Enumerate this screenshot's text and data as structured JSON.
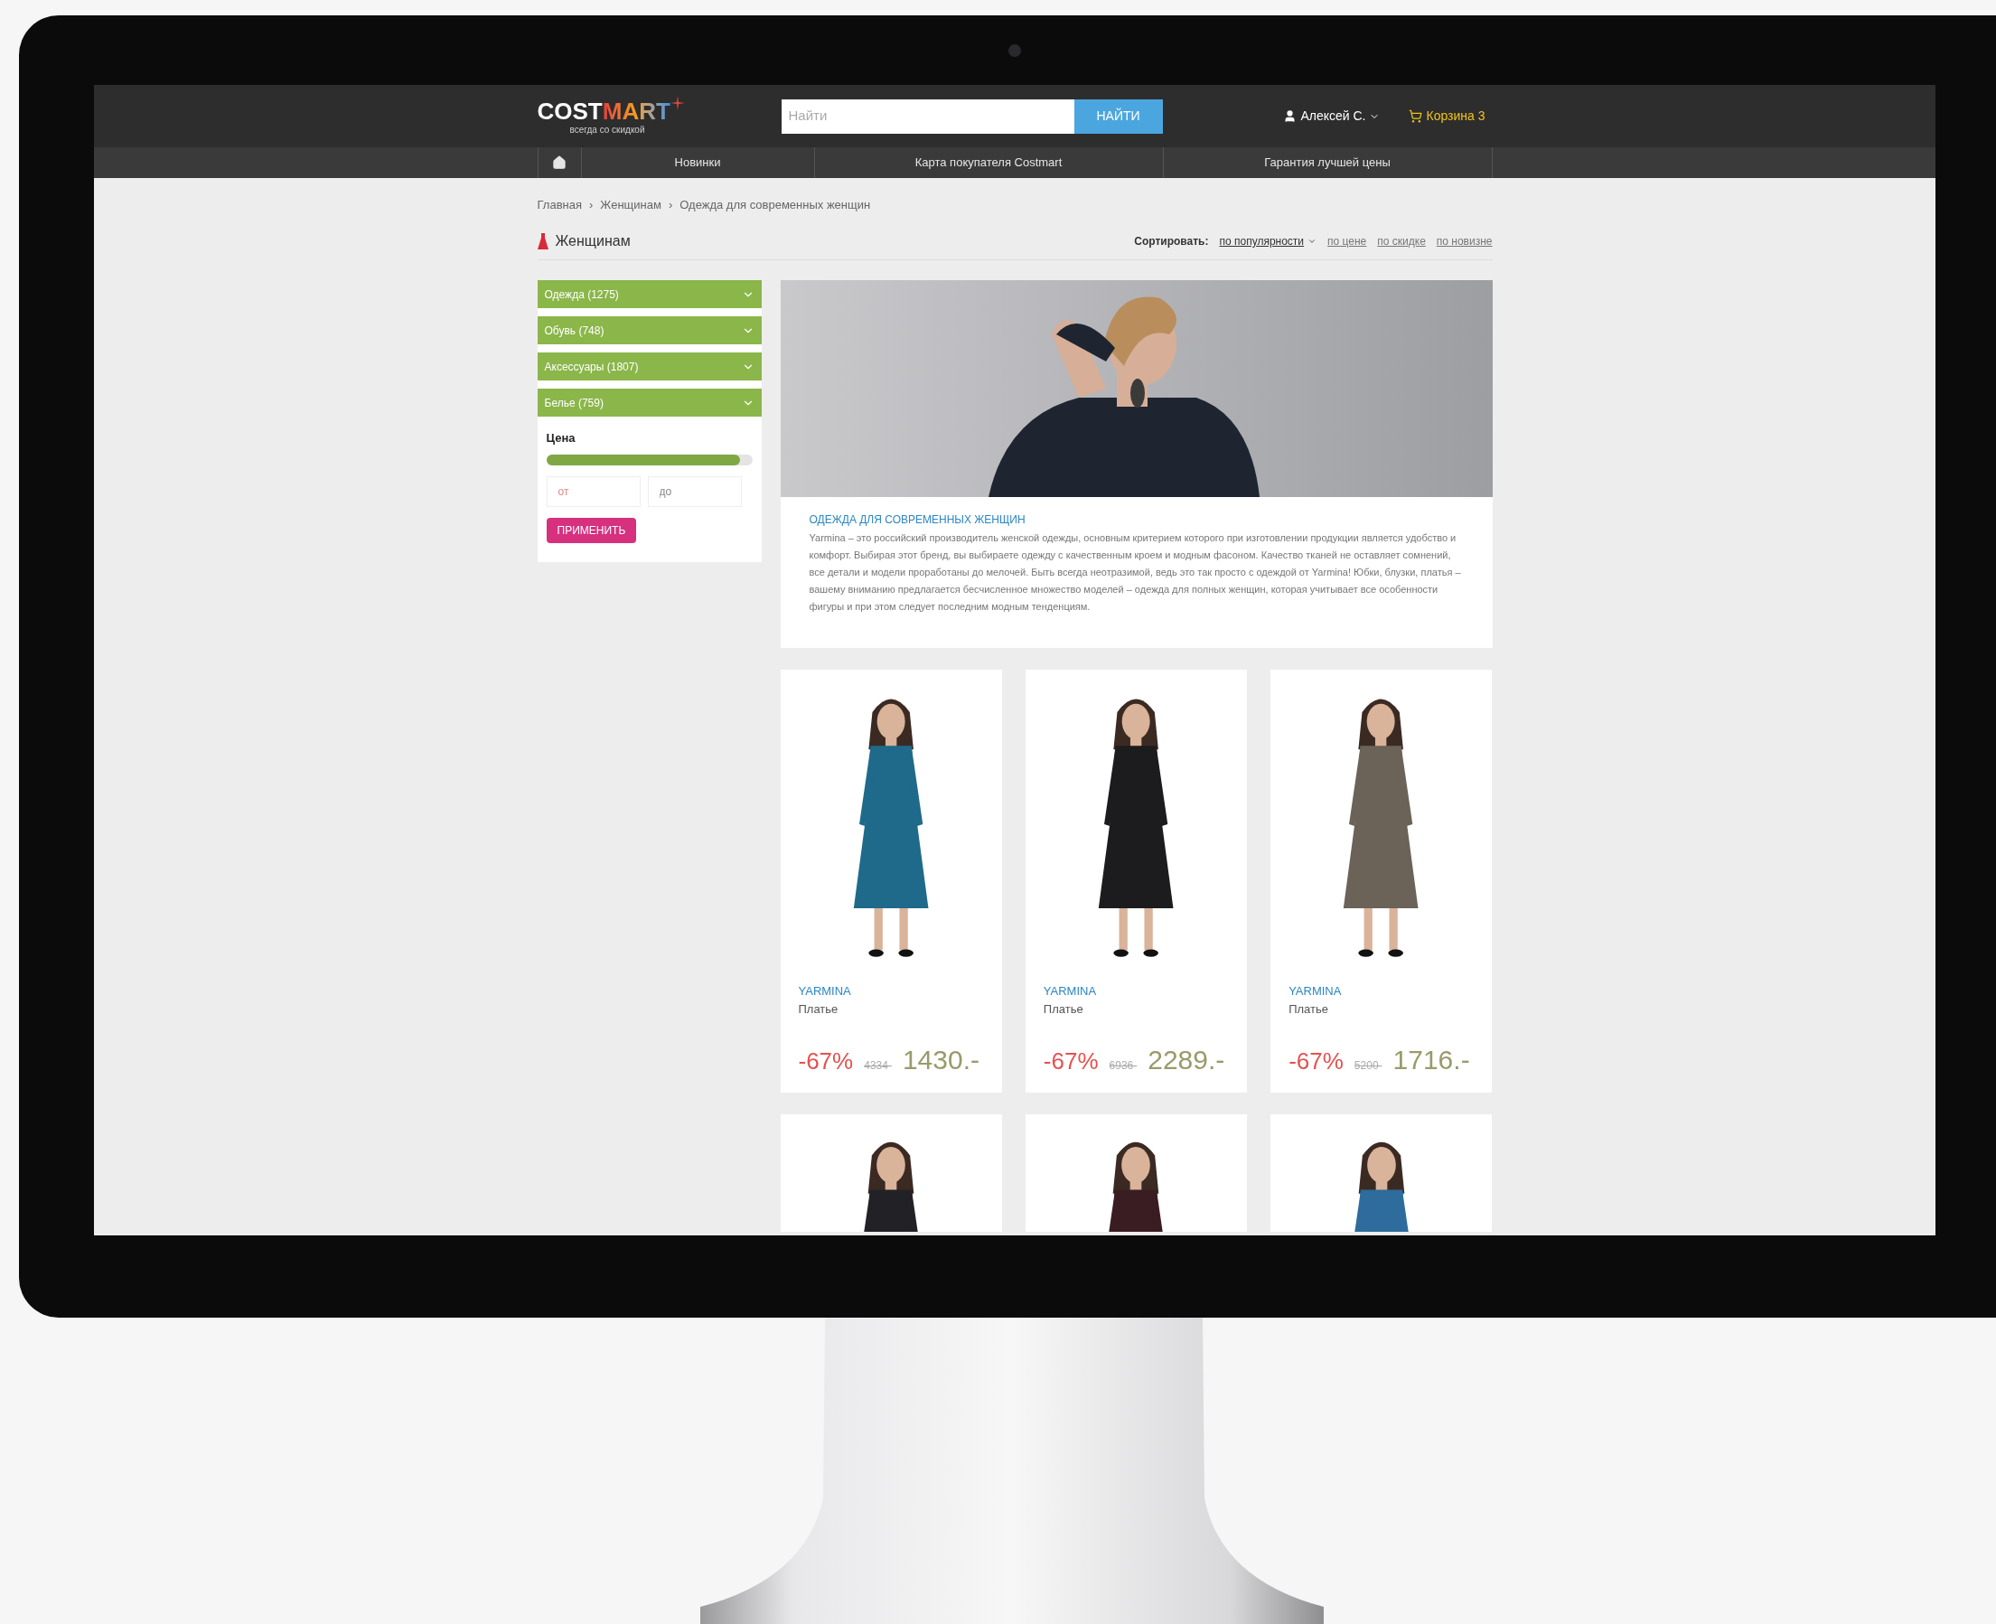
{
  "header": {
    "logo": {
      "text_1": "COST",
      "text_2": "MART",
      "tagline": "всегда со скидкой"
    },
    "search": {
      "placeholder": "Найти",
      "button": "НАЙТИ"
    },
    "user": "Алексей С.",
    "cart": "Корзина 3"
  },
  "nav": {
    "items": [
      "Новинки",
      "Карта покупателя Costmart",
      "Гарантия лучшей цены"
    ]
  },
  "breadcrumbs": [
    {
      "label": "Главная"
    },
    {
      "separator": "›",
      "label": "Женщинам"
    },
    {
      "separator": "›",
      "label": "Одежда для современных женщин"
    }
  ],
  "page_title": "Женщинам",
  "sort": {
    "label": "Сортировать:",
    "options": [
      {
        "label": "по популярности",
        "selected": true
      },
      {
        "label": "по цене",
        "selected": false
      },
      {
        "label": "по скидке",
        "selected": false
      },
      {
        "label": "по новизне",
        "selected": false
      }
    ]
  },
  "filters": {
    "categories": [
      {
        "label": "Одежда (1275)",
        "expanded": false
      },
      {
        "label": "Обувь (748)",
        "expanded": false
      },
      {
        "label": "Аксессуары (1807)",
        "expanded": false
      },
      {
        "label": "Белье (759)",
        "expanded": false
      }
    ],
    "price": {
      "title": "Цена",
      "level": 0.94,
      "from_placeholder": "от",
      "to_placeholder": "до"
    },
    "apply_button": "ПРИМЕНИТЬ"
  },
  "banner": {
    "title": "ОДЕЖДА ДЛЯ СОВРЕМЕННЫХ ЖЕНЩИН",
    "text": "Yarmina – это российский производитель женской одежды, основным критерием которого при изготовлении продукции является удобство и комфорт. Выбирая этот бренд, вы выбираете одежду с качественным кроем и модным фасоном. Качество тканей не оставляет сомнений, все детали и модели проработаны до мелочей. Быть всегда неотразимой, ведь это так просто с одеждой от Yarmina! Юбки, блузки, платья – вашему вниманию предлагается бесчисленное множество моделей – одежда для полных женщин, которая учитывает все особенности фигуры и при этом следует последним модным тенденциям."
  },
  "products": [
    {
      "brand": "YARMINA",
      "type": "Платье",
      "discount": "-67%",
      "old_price": "4334-",
      "price": "1430.-"
    },
    {
      "brand": "YARMINA",
      "type": "Платье",
      "discount": "-67%",
      "old_price": "6936-",
      "price": "2289.-"
    },
    {
      "brand": "YARMINA",
      "type": "Платье",
      "discount": "-67%",
      "old_price": "5200-",
      "price": "1716.-"
    }
  ]
}
